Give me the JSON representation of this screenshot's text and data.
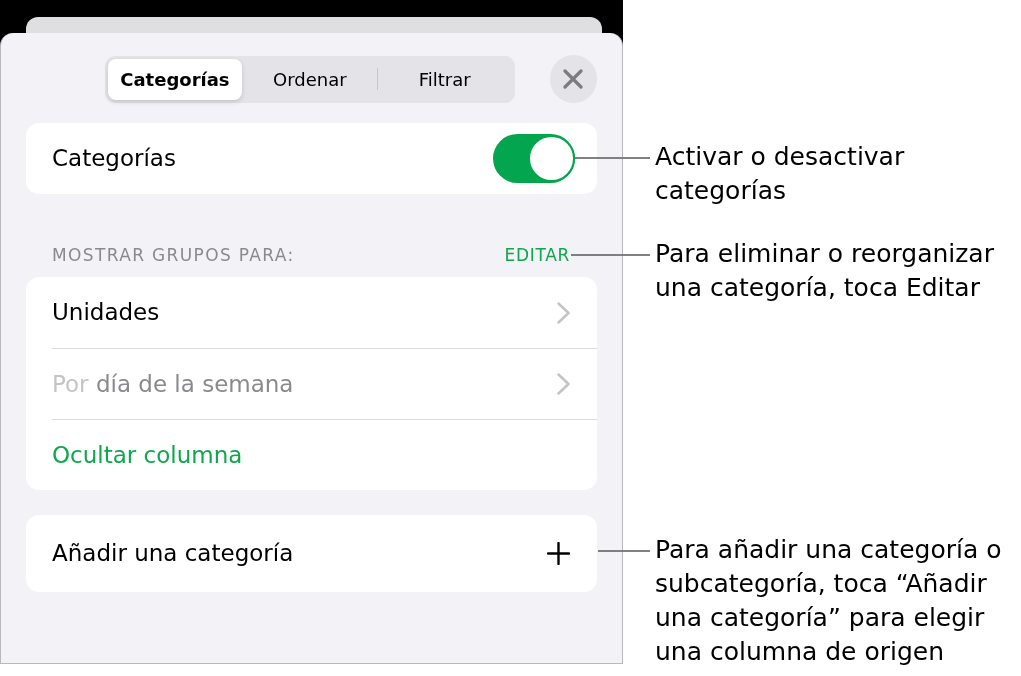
{
  "sheet": {
    "tabs": [
      {
        "label": "Categorías",
        "selected": true
      },
      {
        "label": "Ordenar",
        "selected": false
      },
      {
        "label": "Filtrar",
        "selected": false
      }
    ],
    "categories_toggle": {
      "label": "Categorías",
      "on": true
    },
    "groups_section": {
      "header": "MOSTRAR GRUPOS PARA:",
      "edit_label": "EDITAR",
      "rows": [
        {
          "kind": "nav",
          "label": "Unidades",
          "disabled": false
        },
        {
          "kind": "nav",
          "prefix": "Por",
          "label": "día de la semana",
          "disabled": true
        },
        {
          "kind": "action",
          "label": "Ocultar columna",
          "disabled": false
        }
      ]
    },
    "add_row": {
      "label": "Añadir una categoría"
    }
  },
  "callouts": [
    {
      "text": "Activar o desactivar categorías"
    },
    {
      "text": "Para eliminar o reorganizar una categoría, toca Editar"
    },
    {
      "text": "Para añadir una categoría o subcategoría, toca “Añadir una categoría” para elegir una columna de origen"
    }
  ]
}
